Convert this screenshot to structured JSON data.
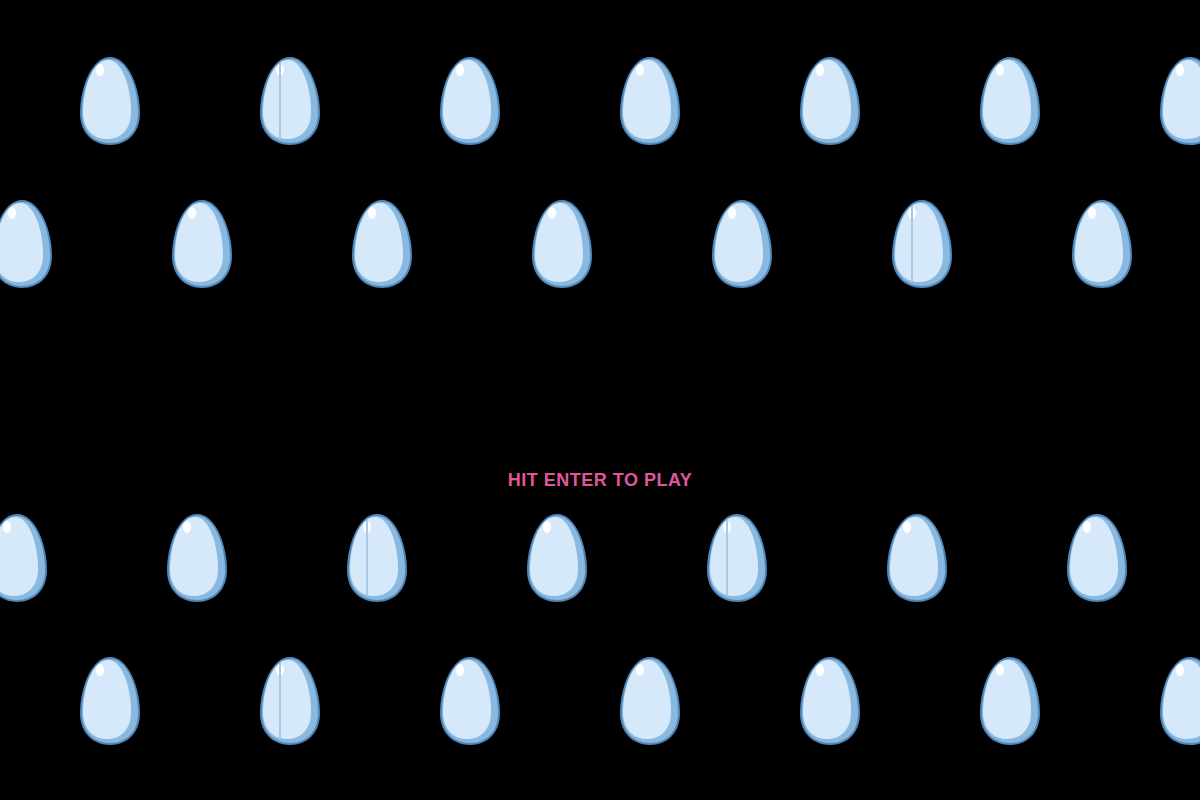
{
  "eggRows": [
    {
      "eggs": [
        {
          "cracked": false
        },
        {
          "cracked": true
        },
        {
          "cracked": false
        },
        {
          "cracked": false
        },
        {
          "cracked": false
        },
        {
          "cracked": false
        },
        {
          "cracked": false
        }
      ]
    },
    {
      "eggs": [
        {
          "cracked": false
        },
        {
          "cracked": false
        },
        {
          "cracked": false
        },
        {
          "cracked": false
        },
        {
          "cracked": false
        },
        {
          "cracked": true
        },
        {
          "cracked": false
        }
      ]
    },
    {
      "eggs": [
        {
          "cracked": false
        },
        {
          "cracked": false
        },
        {
          "cracked": true
        },
        {
          "cracked": false
        },
        {
          "cracked": true
        },
        {
          "cracked": false
        },
        {
          "cracked": false
        }
      ]
    },
    {
      "eggs": [
        {
          "cracked": false
        },
        {
          "cracked": true
        },
        {
          "cracked": false
        },
        {
          "cracked": false
        },
        {
          "cracked": false
        },
        {
          "cracked": false
        },
        {
          "cracked": false
        }
      ]
    }
  ],
  "prompt": "HIT ENTER TO PLAY"
}
